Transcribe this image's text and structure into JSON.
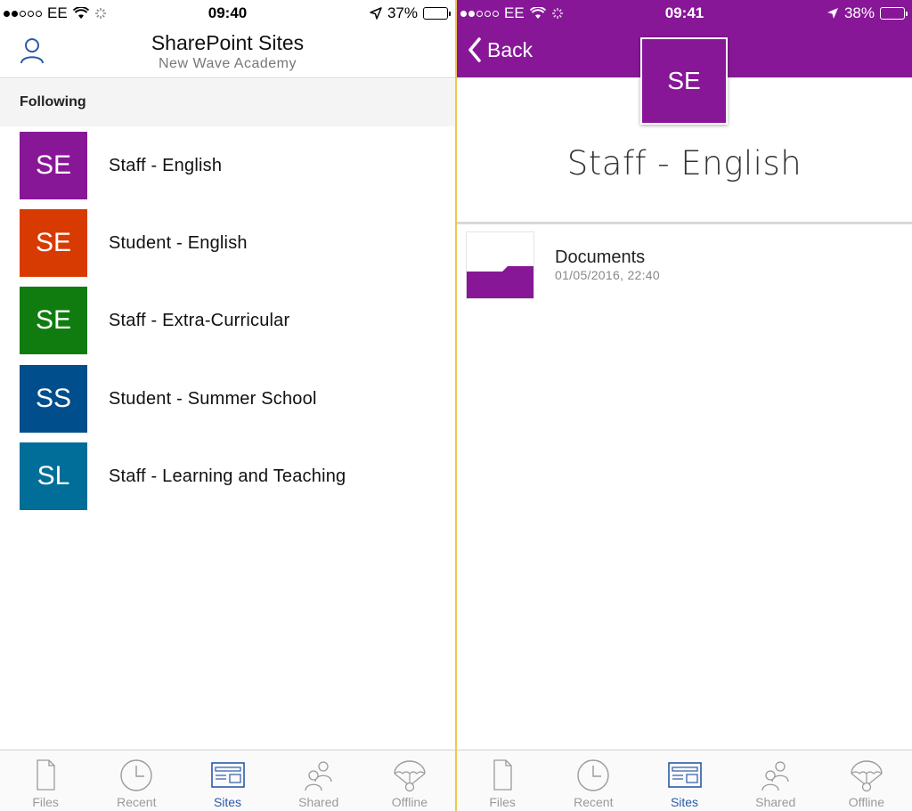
{
  "left": {
    "status": {
      "carrier": "EE",
      "time": "09:40",
      "battery": "37%",
      "battery_level": 0.37
    },
    "header": {
      "title": "SharePoint Sites",
      "subtitle": "New Wave Academy"
    },
    "section_label": "Following",
    "sites": [
      {
        "initials": "SE",
        "name": "Staff - English",
        "color": "#881798"
      },
      {
        "initials": "SE",
        "name": "Student - English",
        "color": "#d83b01"
      },
      {
        "initials": "SE",
        "name": "Staff - Extra-Curricular",
        "color": "#107c10"
      },
      {
        "initials": "SS",
        "name": "Student - Summer School",
        "color": "#004e8c"
      },
      {
        "initials": "SL",
        "name": "Staff - Learning and Teaching",
        "color": "#006e98"
      }
    ]
  },
  "right": {
    "status": {
      "carrier": "EE",
      "time": "09:41",
      "battery": "38%",
      "battery_level": 0.38
    },
    "back_label": "Back",
    "site": {
      "initials": "SE",
      "title": "Staff - English",
      "color": "#881798"
    },
    "library": {
      "name": "Documents",
      "date": "01/05/2016, 22:40"
    }
  },
  "tabs": [
    {
      "label": "Files",
      "icon": "file-icon",
      "active": false
    },
    {
      "label": "Recent",
      "icon": "clock-icon",
      "active": false
    },
    {
      "label": "Sites",
      "icon": "sites-icon",
      "active": true
    },
    {
      "label": "Shared",
      "icon": "people-icon",
      "active": false
    },
    {
      "label": "Offline",
      "icon": "parachute-icon",
      "active": false
    }
  ],
  "colors": {
    "accent": "#881798",
    "tab_active": "#2b5aa8",
    "tab_inactive": "#9a9a9a"
  }
}
